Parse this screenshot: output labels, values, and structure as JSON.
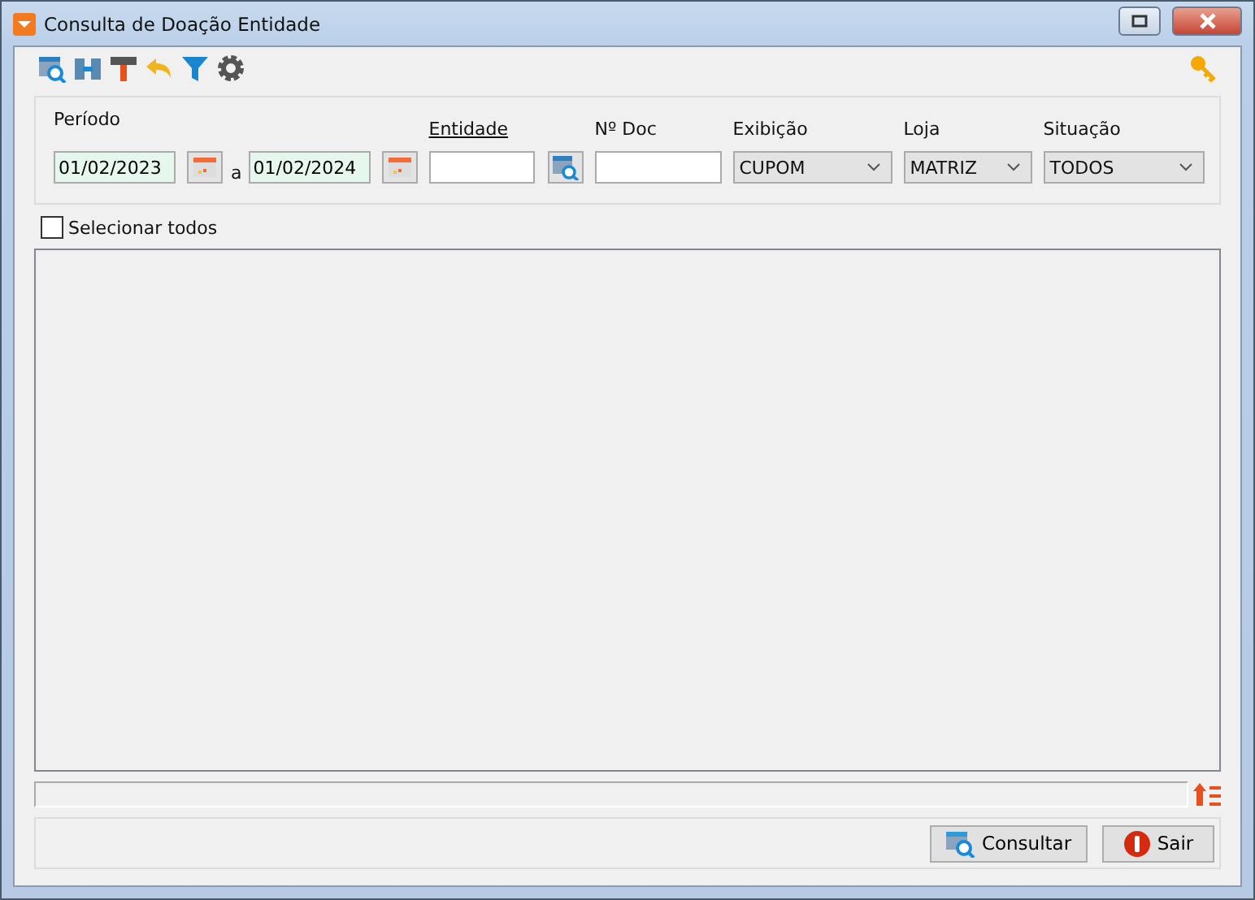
{
  "window": {
    "title": "Consulta de Doação Entidade"
  },
  "filters": {
    "period": {
      "label": "Período",
      "from": "01/02/2023",
      "separator": "a",
      "to": "01/02/2024"
    },
    "entity": {
      "label": "Entidade"
    },
    "doc": {
      "label": "Nº Doc"
    },
    "selects": [
      {
        "label": "Exibição",
        "value": "CUPOM"
      },
      {
        "label": "Loja",
        "value": "MATRIZ"
      },
      {
        "label": "Situação",
        "value": "TODOS"
      }
    ]
  },
  "select_all": {
    "label": "Selecionar todos",
    "checked": false
  },
  "progress": {
    "level": 0
  },
  "buttons": [
    {
      "label": "Consultar",
      "kind": "search"
    },
    {
      "label": "Sair",
      "kind": "exit"
    }
  ]
}
